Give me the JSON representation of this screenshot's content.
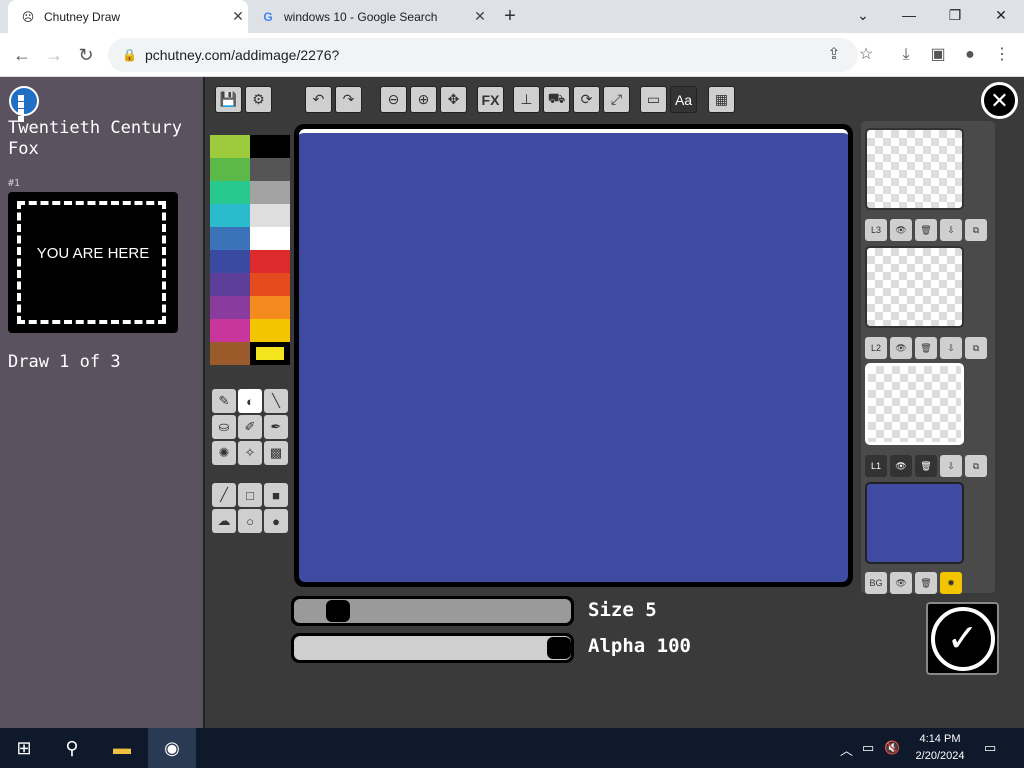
{
  "browser": {
    "tabs": [
      {
        "title": "Chutney Draw",
        "icon": "chutney-favicon"
      },
      {
        "title": "windows 10 - Google Search",
        "icon": "google-favicon"
      }
    ],
    "url": "pchutney.com/addimage/2276?"
  },
  "sidebar": {
    "prompt": "Twentieth Century Fox",
    "index": "#1",
    "card_text": "YOU ARE HERE",
    "draw_count": "Draw 1 of 3"
  },
  "palette": {
    "colors": [
      "#9ccb3b",
      "#000000",
      "#5cb848",
      "#555555",
      "#27c98f",
      "#a3a3a3",
      "#2abccd",
      "#dedede",
      "#3a73b8",
      "#ffffff",
      "#3b4aa1",
      "#dd2b2b",
      "#5d3f9a",
      "#e64a1f",
      "#8a3c9e",
      "#f58a1f",
      "#c9369b",
      "#f2c500",
      "#9a5a2a",
      "#f2e51e"
    ]
  },
  "toolbar": {
    "fx_label": "FX",
    "text_label": "Aa"
  },
  "layers": [
    {
      "label": "L3"
    },
    {
      "label": "L2"
    },
    {
      "label": "L1"
    },
    {
      "label": "BG"
    }
  ],
  "canvas_color": "#3e4ba1",
  "size": {
    "label": "Size 5",
    "value": 5
  },
  "alpha": {
    "label": "Alpha 100",
    "value": 100
  },
  "taskbar": {
    "time": "4:14 PM",
    "date": "2/20/2024"
  }
}
